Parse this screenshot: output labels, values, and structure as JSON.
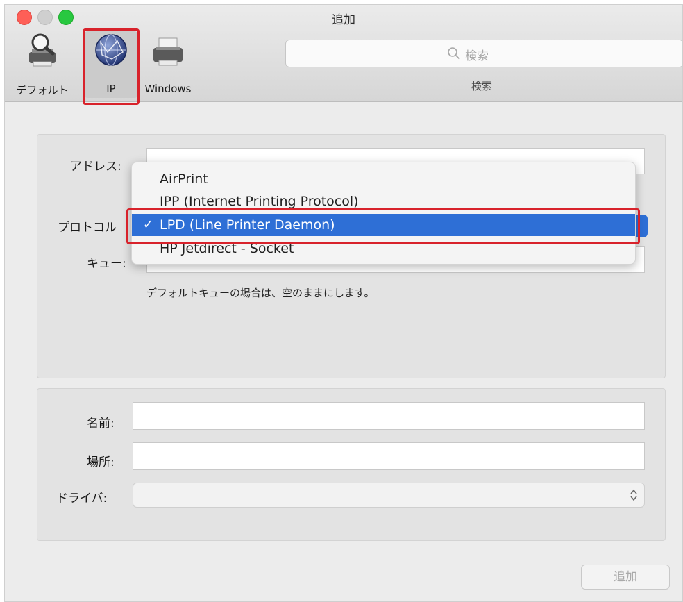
{
  "window": {
    "title": "追加"
  },
  "toolbar": {
    "items": [
      {
        "label": "デフォルト",
        "icon": "default-printer-icon",
        "selected": false
      },
      {
        "label": "IP",
        "icon": "globe-network-icon",
        "selected": true
      },
      {
        "label": "Windows",
        "icon": "windows-printer-icon",
        "selected": false
      }
    ],
    "search": {
      "placeholder": "検索",
      "caption": "検索"
    }
  },
  "form": {
    "address_label": "アドレス:",
    "protocol_label": "プロトコル",
    "queue_label": "キュー:",
    "queue_hint": "デフォルトキューの場合は、空のままにします。",
    "name_label": "名前:",
    "location_label": "場所:",
    "driver_label": "ドライバ:"
  },
  "protocol_menu": {
    "options": [
      {
        "label": "AirPrint",
        "selected": false
      },
      {
        "label": "IPP (Internet Printing Protocol)",
        "selected": false
      },
      {
        "label": "LPD (Line Printer Daemon)",
        "selected": true
      },
      {
        "label": "HP Jetdirect - Socket",
        "selected": false
      }
    ],
    "checkmark": "✓"
  },
  "buttons": {
    "add": "追加"
  },
  "colors": {
    "selection": "#2e6fd6",
    "highlight": "#d8222b",
    "close": "#fe5f57",
    "maximize": "#28c840"
  }
}
